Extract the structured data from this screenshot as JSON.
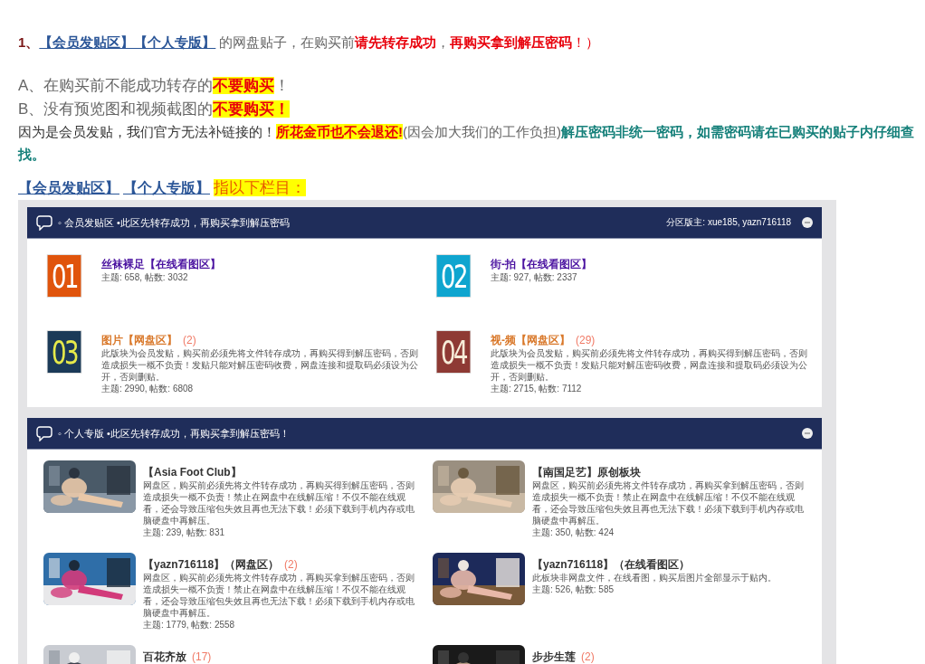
{
  "notice": [
    {
      "kind": "medium",
      "segments": [
        {
          "kind": "lead",
          "text": "1、"
        },
        {
          "kind": "link",
          "text": "【会员发贴区】【个人专版】"
        },
        {
          "kind": "plain",
          "text": "的网盘贴子，在购买前"
        },
        {
          "kind": "alert",
          "text": "请先转存成功"
        },
        {
          "kind": "plain",
          "text": "，"
        },
        {
          "kind": "alert",
          "text": "再购买拿到解压密码"
        },
        {
          "kind": "alert-light",
          "text": "！）"
        }
      ]
    },
    {
      "kind": "large",
      "segments": [
        {
          "kind": "plain",
          "text": "A、在购买前不能成功转存的"
        },
        {
          "kind": "highlight",
          "text": "不要购买"
        },
        {
          "kind": "plain",
          "text": "！"
        }
      ]
    },
    {
      "kind": "large",
      "segments": [
        {
          "kind": "plain",
          "text": "B、没有预览图和视频截图的"
        },
        {
          "kind": "highlight",
          "text": "不要购买！"
        }
      ]
    },
    {
      "kind": "medium",
      "segments": [
        {
          "kind": "dark",
          "text": "因为是会员发贴，我们官方无法补链接的！"
        },
        {
          "kind": "highlight",
          "text": "所花金币也不会退还!"
        },
        {
          "kind": "plain",
          "text": "(因会加大我们的工作负担)"
        },
        {
          "kind": "teal",
          "text": "解压密码非统一密码，如需密码请在已购买的贴子内仔细查找。"
        }
      ]
    },
    {
      "kind": "banner",
      "segments": [
        {
          "kind": "link",
          "text": "【会员发贴区】"
        },
        {
          "kind": "link",
          "text": "【个人专版】"
        },
        {
          "kind": "banner",
          "text": "指以下栏目："
        }
      ]
    }
  ],
  "board": {
    "sections": [
      {
        "kind": "numbered",
        "title": "◦ 会员发贴区 •此区先转存成功，再购买拿到解压密码",
        "moderators": "分区版主: xue185, yazn716118",
        "collapsed": false,
        "forums": [
          {
            "tile": {
              "color": "#e0540c"
            },
            "number": {
              "text": "01",
              "color": "#ffffff"
            },
            "new": false,
            "title": "丝袜裸足【在线看图区】",
            "stats": "主题: 658, 帖数: 3032"
          },
          {
            "tile": {
              "color": "#0fa5cf"
            },
            "number": {
              "text": "02",
              "color": "#ffffff"
            },
            "new": false,
            "title": "街-拍【在线看图区】",
            "stats": "主题: 927, 帖数: 2337"
          },
          {
            "tile": {
              "color": "#1b3a58"
            },
            "number": {
              "text": "03",
              "color": "#e6ea4a"
            },
            "new": true,
            "title": "图片【网盘区】",
            "count": "(2)",
            "description": "此版块为会员发贴，购买前必须先将文件转存成功，再购买得到解压密码，否则造成损失一概不负责！发贴只能对解压密码收费，网盘连接和提取码必须设为公开，否则删贴。",
            "stats": "主题: 2990, 帖数: 6808"
          },
          {
            "tile": {
              "color": "#8e3a34"
            },
            "number": {
              "text": "04",
              "color": "#f6ecd8"
            },
            "new": true,
            "title": "视-频【网盘区】",
            "count": "(29)",
            "description": "此版块为会员发贴，购买前必须先将文件转存成功，再购买得到解压密码，否则造成损失一概不负责！发贴只能对解压密码收费，网盘连接和提取码必须设为公开，否则删贴。",
            "stats": "主题: 2715, 帖数: 7112"
          }
        ]
      },
      {
        "kind": "thumbnail",
        "title": "◦ 个人专版 •此区先转存成功，再购买拿到解压密码！",
        "collapsed": false,
        "forums": [
          {
            "title": "【Asia Foot Club】",
            "description": "网盘区，购买前必须先将文件转存成功，再购买得到解压密码，否则造成损失一概不负责！禁止在网盘中在线解压缩！不仅不能在线观看，还会导致压缩包失效且再也无法下载！必须下载到手机内存或电脑硬盘中再解压。",
            "stats": "主题: 239, 帖数: 831"
          },
          {
            "title": "【南国足艺】原创板块",
            "description": "网盘区，购买前必须先将文件转存成功，再购买拿到解压密码，否则造成损失一概不负责！禁止在网盘中在线解压缩！不仅不能在线观看，还会导致压缩包失效且再也无法下载！必须下载到手机内存或电脑硬盘中再解压。",
            "stats": "主题: 350, 帖数: 424"
          },
          {
            "title": "【yazn716118】（网盘区）",
            "count": "(2)",
            "description": "网盘区，购买前必须先将文件转存成功，再购买拿到解压密码，否则造成损失一概不负责！禁止在网盘中在线解压缩！不仅不能在线观看，还会导致压缩包失效且再也无法下载！必须下载到手机内存或电脑硬盘中再解压。",
            "stats": "主题: 1779, 帖数: 2558"
          },
          {
            "title": "【yazn716118】（在线看图区）",
            "description": "此板块非网盘文件，在线看图，购买后图片全部显示于贴内。",
            "stats": "主题: 526, 帖数: 585"
          },
          {
            "title": "百花齐放",
            "count": "(17)"
          },
          {
            "title": "步步生莲",
            "count": "(2)"
          }
        ]
      }
    ]
  }
}
